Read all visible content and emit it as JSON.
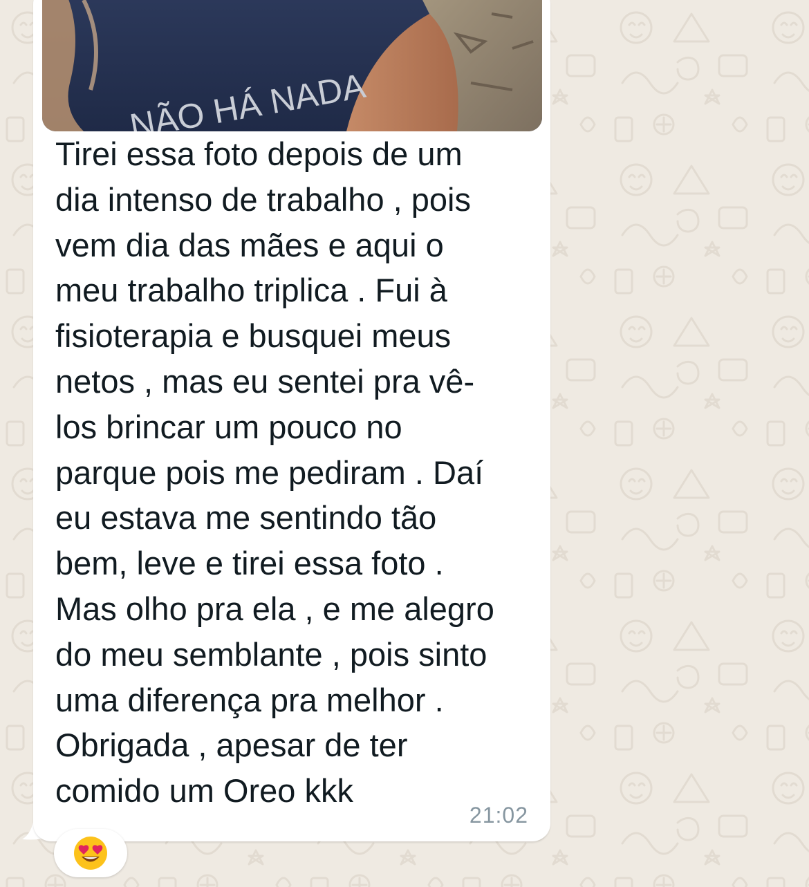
{
  "chat": {
    "message": {
      "image_caption_on_shirt": "NÃO HÁ NADA",
      "text": "Tirei essa foto depois de um\ndia intenso de trabalho , pois\nvem dia das mães e aqui o\nmeu trabalho triplica . Fui à\nfisioterapia e busquei meus\nnetos , mas eu sentei pra vê-\nlos brincar um pouco no\nparque pois me pediram . Daí\neu estava me sentindo tão\nbem, leve e tirei essa foto .\nMas olho pra ela , e me alegro\ndo meu semblante , pois sinto\numa diferença pra melhor .\nObrigada , apesar de ter\ncomido um Oreo kkk",
      "time": "21:02",
      "reaction": {
        "emoji": "😍",
        "icon": "heart-eyes-emoji-icon"
      }
    }
  },
  "colors": {
    "wallpaper": "#efeae2",
    "bubble": "#ffffff",
    "text": "#111b21",
    "timestamp": "#8696a0"
  }
}
